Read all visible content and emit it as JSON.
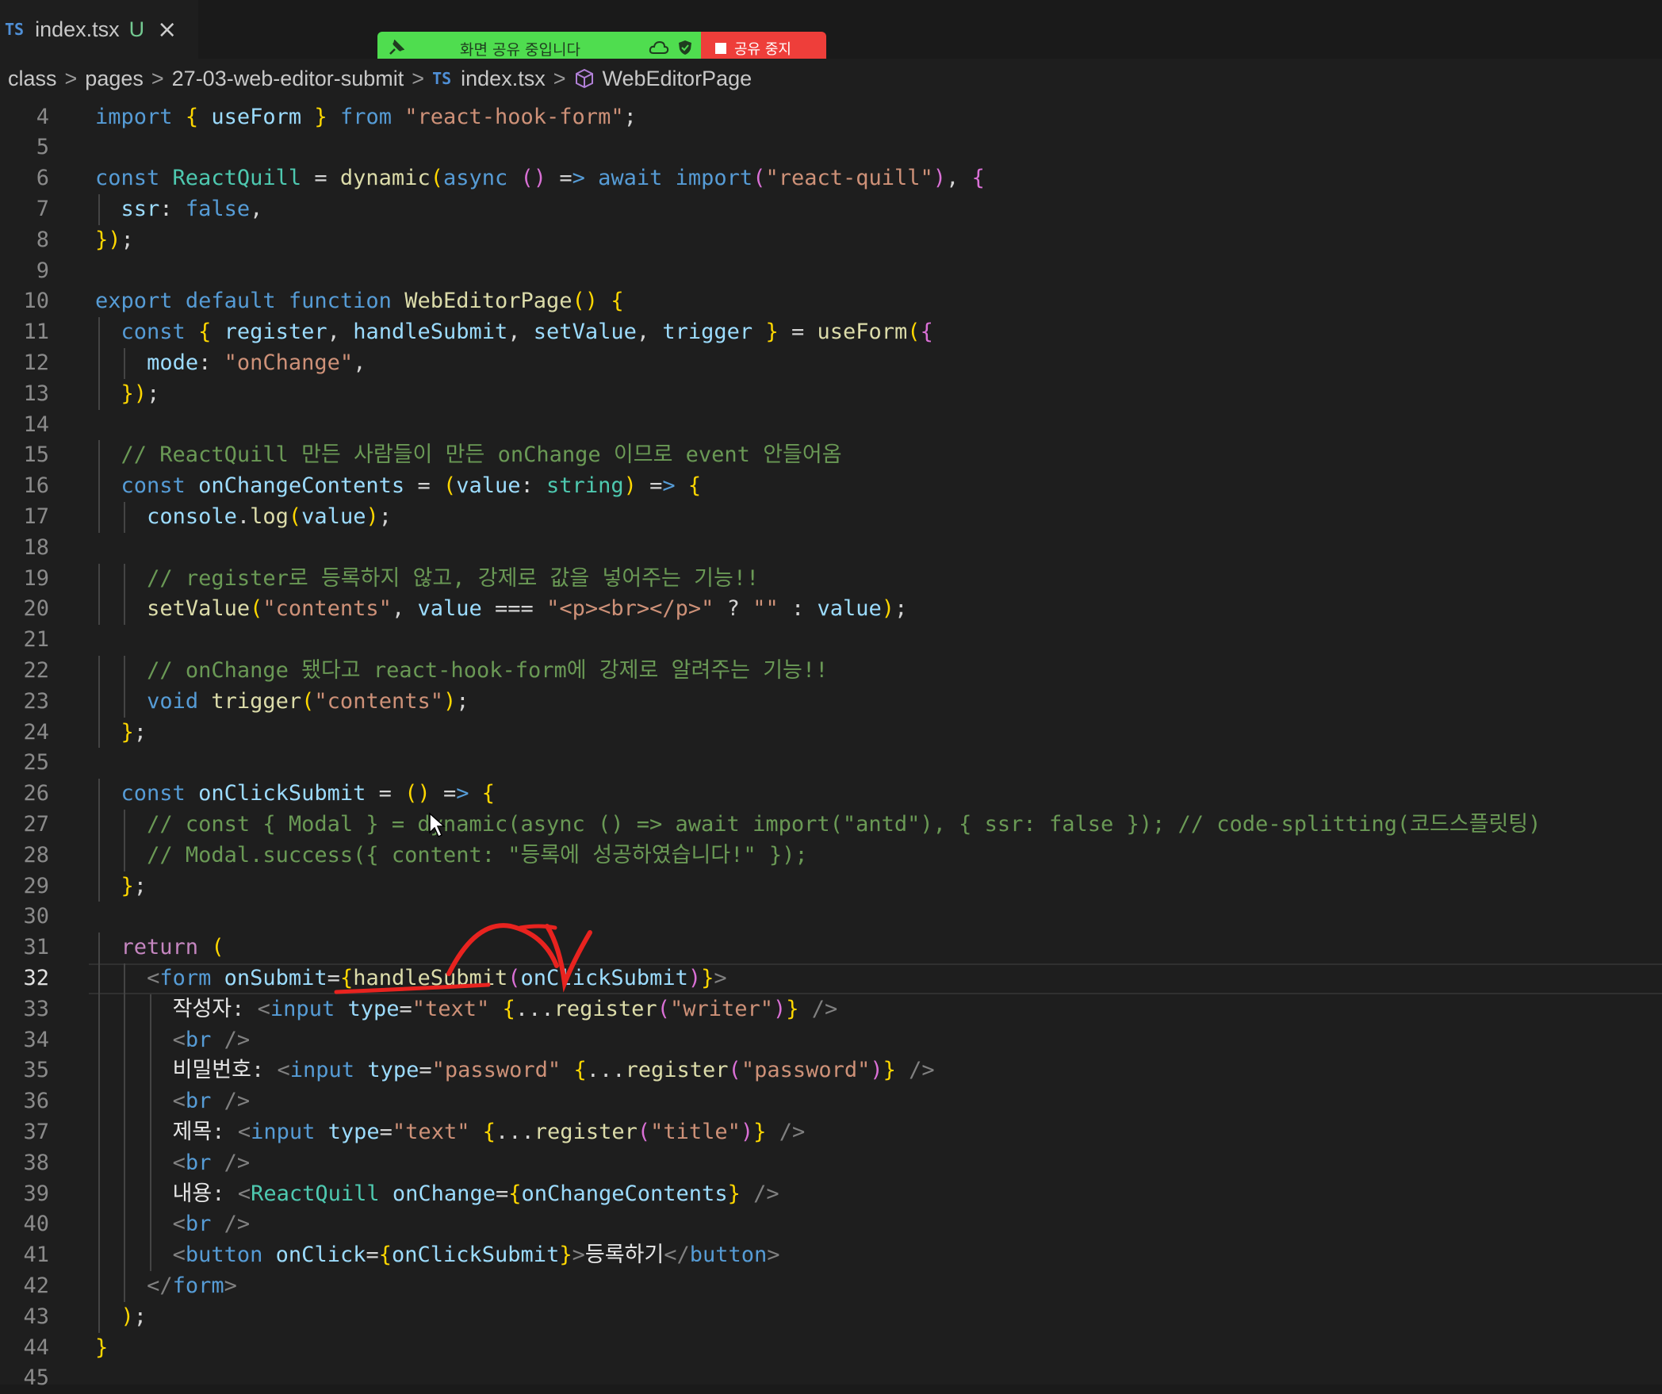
{
  "tab": {
    "lang_badge": "TS",
    "filename": "index.tsx",
    "status": "U",
    "close_icon": "×"
  },
  "share_bar": {
    "text": "화면 공유 중입니다",
    "stop_label": "공유 중지",
    "colors": {
      "green": "#4fdd4f",
      "red": "#ee3e3a"
    }
  },
  "breadcrumb": {
    "items": [
      "class",
      "pages",
      "27-03-web-editor-submit",
      "index.tsx",
      "WebEditorPage"
    ],
    "ts_badge": "TS",
    "separator": ">"
  },
  "editor": {
    "active_line": 32,
    "lines": [
      {
        "n": "4",
        "t": "import { useForm } from \"react-hook-form\";"
      },
      {
        "n": "5",
        "t": ""
      },
      {
        "n": "6",
        "t": "const ReactQuill = dynamic(async () => await import(\"react-quill\"), {"
      },
      {
        "n": "7",
        "t": "  ssr: false,"
      },
      {
        "n": "8",
        "t": "});"
      },
      {
        "n": "9",
        "t": ""
      },
      {
        "n": "10",
        "t": "export default function WebEditorPage() {"
      },
      {
        "n": "11",
        "t": "  const { register, handleSubmit, setValue, trigger } = useForm({"
      },
      {
        "n": "12",
        "t": "    mode: \"onChange\","
      },
      {
        "n": "13",
        "t": "  });"
      },
      {
        "n": "14",
        "t": ""
      },
      {
        "n": "15",
        "t": "  // ReactQuill 만든 사람들이 만든 onChange 이므로 event 안들어옴"
      },
      {
        "n": "16",
        "t": "  const onChangeContents = (value: string) => {"
      },
      {
        "n": "17",
        "t": "    console.log(value);"
      },
      {
        "n": "18",
        "t": ""
      },
      {
        "n": "19",
        "t": "    // register로 등록하지 않고, 강제로 값을 넣어주는 기능!!"
      },
      {
        "n": "20",
        "t": "    setValue(\"contents\", value === \"<p><br></p>\" ? \"\" : value);"
      },
      {
        "n": "21",
        "t": ""
      },
      {
        "n": "22",
        "t": "    // onChange 됐다고 react-hook-form에 강제로 알려주는 기능!!"
      },
      {
        "n": "23",
        "t": "    void trigger(\"contents\");"
      },
      {
        "n": "24",
        "t": "  };"
      },
      {
        "n": "25",
        "t": ""
      },
      {
        "n": "26",
        "t": "  const onClickSubmit = () => {"
      },
      {
        "n": "27",
        "t": "    // const { Modal } = dynamic(async () => await import(\"antd\"), { ssr: false }); // code-splitting(코드스플릿팅)"
      },
      {
        "n": "28",
        "t": "    // Modal.success({ content: \"등록에 성공하였습니다!\" });"
      },
      {
        "n": "29",
        "t": "  };"
      },
      {
        "n": "30",
        "t": ""
      },
      {
        "n": "31",
        "t": "  return ("
      },
      {
        "n": "32",
        "t": "    <form onSubmit={handleSubmit(onClickSubmit)}>"
      },
      {
        "n": "33",
        "t": "      작성자: <input type=\"text\" {...register(\"writer\")} />"
      },
      {
        "n": "34",
        "t": "      <br />"
      },
      {
        "n": "35",
        "t": "      비밀번호: <input type=\"password\" {...register(\"password\")} />"
      },
      {
        "n": "36",
        "t": "      <br />"
      },
      {
        "n": "37",
        "t": "      제목: <input type=\"text\" {...register(\"title\")} />"
      },
      {
        "n": "38",
        "t": "      <br />"
      },
      {
        "n": "39",
        "t": "      내용: <ReactQuill onChange={onChangeContents} />"
      },
      {
        "n": "40",
        "t": "      <br />"
      },
      {
        "n": "41",
        "t": "      <button onClick={onClickSubmit}>등록하기</button>"
      },
      {
        "n": "42",
        "t": "    </form>"
      },
      {
        "n": "43",
        "t": "  );"
      },
      {
        "n": "44",
        "t": "}"
      },
      {
        "n": "45",
        "t": ""
      }
    ]
  },
  "annotation": {
    "color": "#e8231f"
  }
}
